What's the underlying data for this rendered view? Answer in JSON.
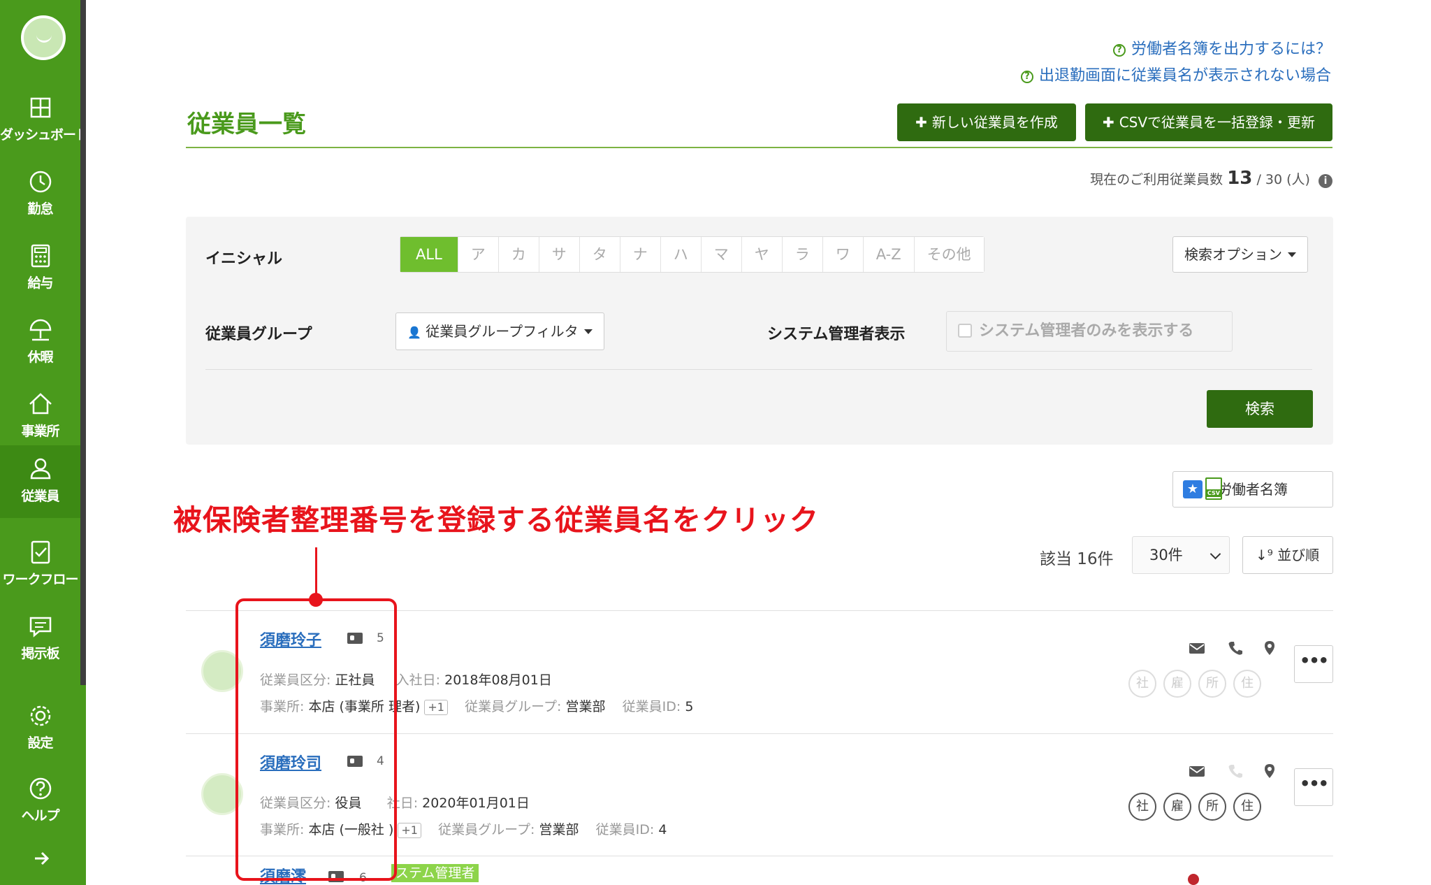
{
  "sidebar": {
    "items": [
      {
        "label": "ダッシュボード",
        "icon": "dashboard-icon"
      },
      {
        "label": "勤怠",
        "icon": "clock-icon"
      },
      {
        "label": "給与",
        "icon": "calculator-icon"
      },
      {
        "label": "休暇",
        "icon": "umbrella-icon"
      },
      {
        "label": "事業所",
        "icon": "home-icon"
      },
      {
        "label": "従業員",
        "icon": "user-icon"
      },
      {
        "label": "ワークフロー",
        "icon": "workflow-icon"
      },
      {
        "label": "掲示板",
        "icon": "message-icon"
      },
      {
        "label": "設定",
        "icon": "gear-icon"
      },
      {
        "label": "ヘルプ",
        "icon": "help-icon"
      }
    ],
    "active": "従業員"
  },
  "help_links": {
    "roster": "労働者名簿を出力するには？",
    "attendance": "出退勤画面に従業員名が表示されない場合"
  },
  "header": {
    "title": "従業員一覧",
    "new_employee_button": "新しい従業員を作成",
    "csv_button": "CSVで従業員を一括登録・更新"
  },
  "usage": {
    "prefix": "現在のご利用従業員数",
    "current": "13",
    "separator": "/",
    "limit": "30 (人)"
  },
  "filter": {
    "initial_label": "イニシャル",
    "initials": [
      "ALL",
      "ア",
      "カ",
      "サ",
      "タ",
      "ナ",
      "ハ",
      "マ",
      "ヤ",
      "ラ",
      "ワ",
      "A-Z",
      "その他"
    ],
    "active_initial": "ALL",
    "search_options": "検索オプション",
    "group_label": "従業員グループ",
    "group_filter": "従業員グループフィルタ",
    "sysadmin_label": "システム管理者表示",
    "sysadmin_checkbox": "システム管理者のみを表示する",
    "search_button": "検索"
  },
  "roster_button": {
    "label": "労働者名簿",
    "csv_badge": "CSV"
  },
  "annotation": {
    "text": "被保険者整理番号を登録する従業員名をクリック"
  },
  "results": {
    "count": "該当 16件",
    "per_page": "30件",
    "sort_label": "並び順"
  },
  "employees": [
    {
      "name": "須磨玲子",
      "card_count": "5",
      "type_label": "従業員区分:",
      "type": "正社員",
      "join_label": "入社日:",
      "join_date": "2018年08月01日",
      "office_label": "事業所:",
      "office": "本店 (事業所 理者)",
      "office_extra": "+1",
      "group_label": "従業員グループ:",
      "group": "営業部",
      "id_label": "従業員ID:",
      "id": "5",
      "insurance": [
        "社",
        "雇",
        "所",
        "住"
      ]
    },
    {
      "name": "須磨玲司",
      "card_count": "4",
      "type_label": "従業員区分:",
      "type": "役員",
      "join_label": "社日:",
      "join_date": "2020年01月01日",
      "office_label": "事業所:",
      "office": "本店 (一般社 )",
      "office_extra": "+1",
      "group_label": "従業員グループ:",
      "group": "営業部",
      "id_label": "従業員ID:",
      "id": "4",
      "insurance": [
        "社",
        "雇",
        "所",
        "住"
      ]
    },
    {
      "name": "須磨澪",
      "card_count": "6",
      "tag": "ステム管理者"
    }
  ],
  "colors": {
    "sidebar": "#4a9a1c",
    "accent": "#4a9a1c",
    "button_dark": "#2f6b10",
    "link": "#2a6ebd",
    "annotation": "#e8141c"
  }
}
